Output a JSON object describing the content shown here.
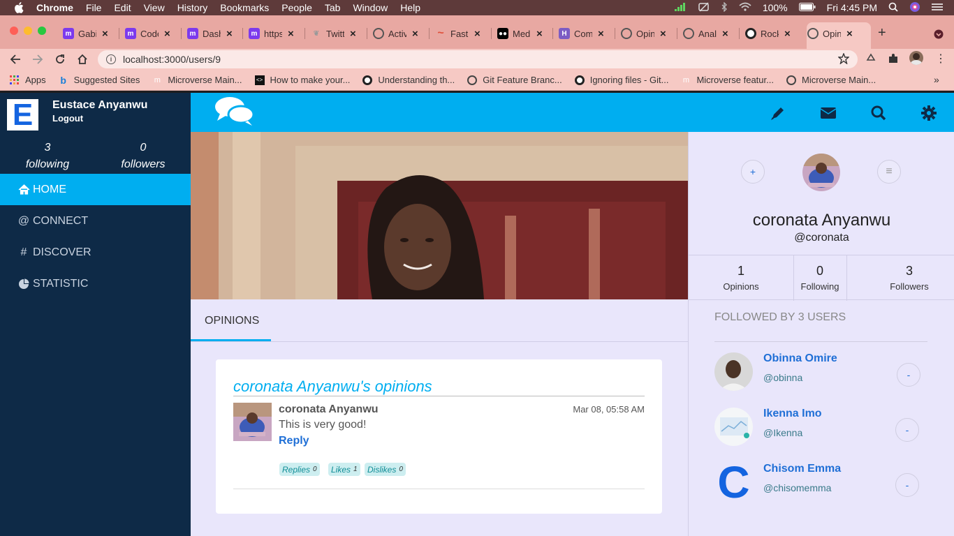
{
  "menubar": {
    "app": "Chrome",
    "items": [
      "File",
      "Edit",
      "View",
      "History",
      "Bookmarks",
      "People",
      "Tab",
      "Window",
      "Help"
    ],
    "battery": "100%",
    "clock": "Fri 4:45 PM"
  },
  "tabs": [
    {
      "title": "Gabi",
      "favicon": "microverse-icon",
      "color": "#7c3aed"
    },
    {
      "title": "Code",
      "favicon": "microverse-icon",
      "color": "#7c3aed"
    },
    {
      "title": "Dash",
      "favicon": "microverse-icon",
      "color": "#7c3aed"
    },
    {
      "title": "https",
      "favicon": "microverse-icon",
      "color": "#7c3aed"
    },
    {
      "title": "Twitt",
      "favicon": "bird-icon",
      "color": "#e8a8a2"
    },
    {
      "title": "Activ",
      "favicon": "globe-icon",
      "color": "#555555"
    },
    {
      "title": "Fastr",
      "favicon": "wave-icon",
      "color": "#e8a8a2"
    },
    {
      "title": "Medi",
      "favicon": "medium-icon",
      "color": "#000000"
    },
    {
      "title": "Com",
      "favicon": "heroku-icon",
      "color": "#7c5cc4"
    },
    {
      "title": "Opin",
      "favicon": "globe-icon",
      "color": "#555555"
    },
    {
      "title": "Anal",
      "favicon": "globe-icon",
      "color": "#555555"
    },
    {
      "title": "Rock",
      "favicon": "github-icon",
      "color": "#222222"
    },
    {
      "title": "Opin",
      "favicon": "globe-icon",
      "color": "#555555",
      "active": true
    }
  ],
  "address": {
    "url": "localhost:3000/users/9"
  },
  "bookmarks": [
    {
      "label": "Apps",
      "icon": "apps-grid-icon"
    },
    {
      "label": "Suggested Sites",
      "icon": "bing-icon"
    },
    {
      "label": "Microverse Main...",
      "icon": "microverse-icon"
    },
    {
      "label": "How to make your...",
      "icon": "code-icon"
    },
    {
      "label": "Understanding th...",
      "icon": "github-icon"
    },
    {
      "label": "Git Feature Branc...",
      "icon": "globe-icon"
    },
    {
      "label": "Ignoring files - Git...",
      "icon": "github-icon"
    },
    {
      "label": "Microverse featur...",
      "icon": "microverse-icon"
    },
    {
      "label": "Microverse Main...",
      "icon": "globe-icon"
    }
  ],
  "sidebar": {
    "logo_letter": "E",
    "user_name": "Eustace Anyanwu",
    "logout": "Logout",
    "following_count": "3",
    "following_label": "following",
    "followers_count": "0",
    "followers_label": "followers",
    "nav": [
      {
        "label": "HOME",
        "icon": "home-icon",
        "active": true
      },
      {
        "label": "CONNECT",
        "icon": "at-icon"
      },
      {
        "label": "DISCOVER",
        "icon": "hash-icon"
      },
      {
        "label": "STATISTIC",
        "icon": "pie-chart-icon"
      }
    ]
  },
  "main": {
    "tab_label": "OPINIONS",
    "card": {
      "title": "coronata Anyanwu's opinions",
      "author": "coronata Anyanwu",
      "date": "Mar 08, 05:58 AM",
      "text": "This is very good!",
      "reply": "Reply",
      "pills": [
        {
          "label": "Replies",
          "count": "0"
        },
        {
          "label": "Likes",
          "count": "1"
        },
        {
          "label": "Dislikes",
          "count": "0"
        }
      ]
    }
  },
  "profile": {
    "follow_btn": "+",
    "menu_btn": "≡",
    "name": "coronata Anyanwu",
    "handle": "@coronata",
    "stats": [
      {
        "value": "1",
        "label": "Opinions"
      },
      {
        "value": "0",
        "label": "Following"
      },
      {
        "value": "3",
        "label": "Followers"
      }
    ],
    "followed_by": "FOLLOWED BY 3 USERS",
    "followers": [
      {
        "name": "Obinna Omire",
        "handle": "@obinna",
        "btn": "-"
      },
      {
        "name": "Ikenna Imo",
        "handle": "@Ikenna",
        "btn": "-"
      },
      {
        "name": "Chisom Emma",
        "handle": "@chisomemma",
        "btn": "-",
        "avatar_letter": "C"
      }
    ]
  }
}
